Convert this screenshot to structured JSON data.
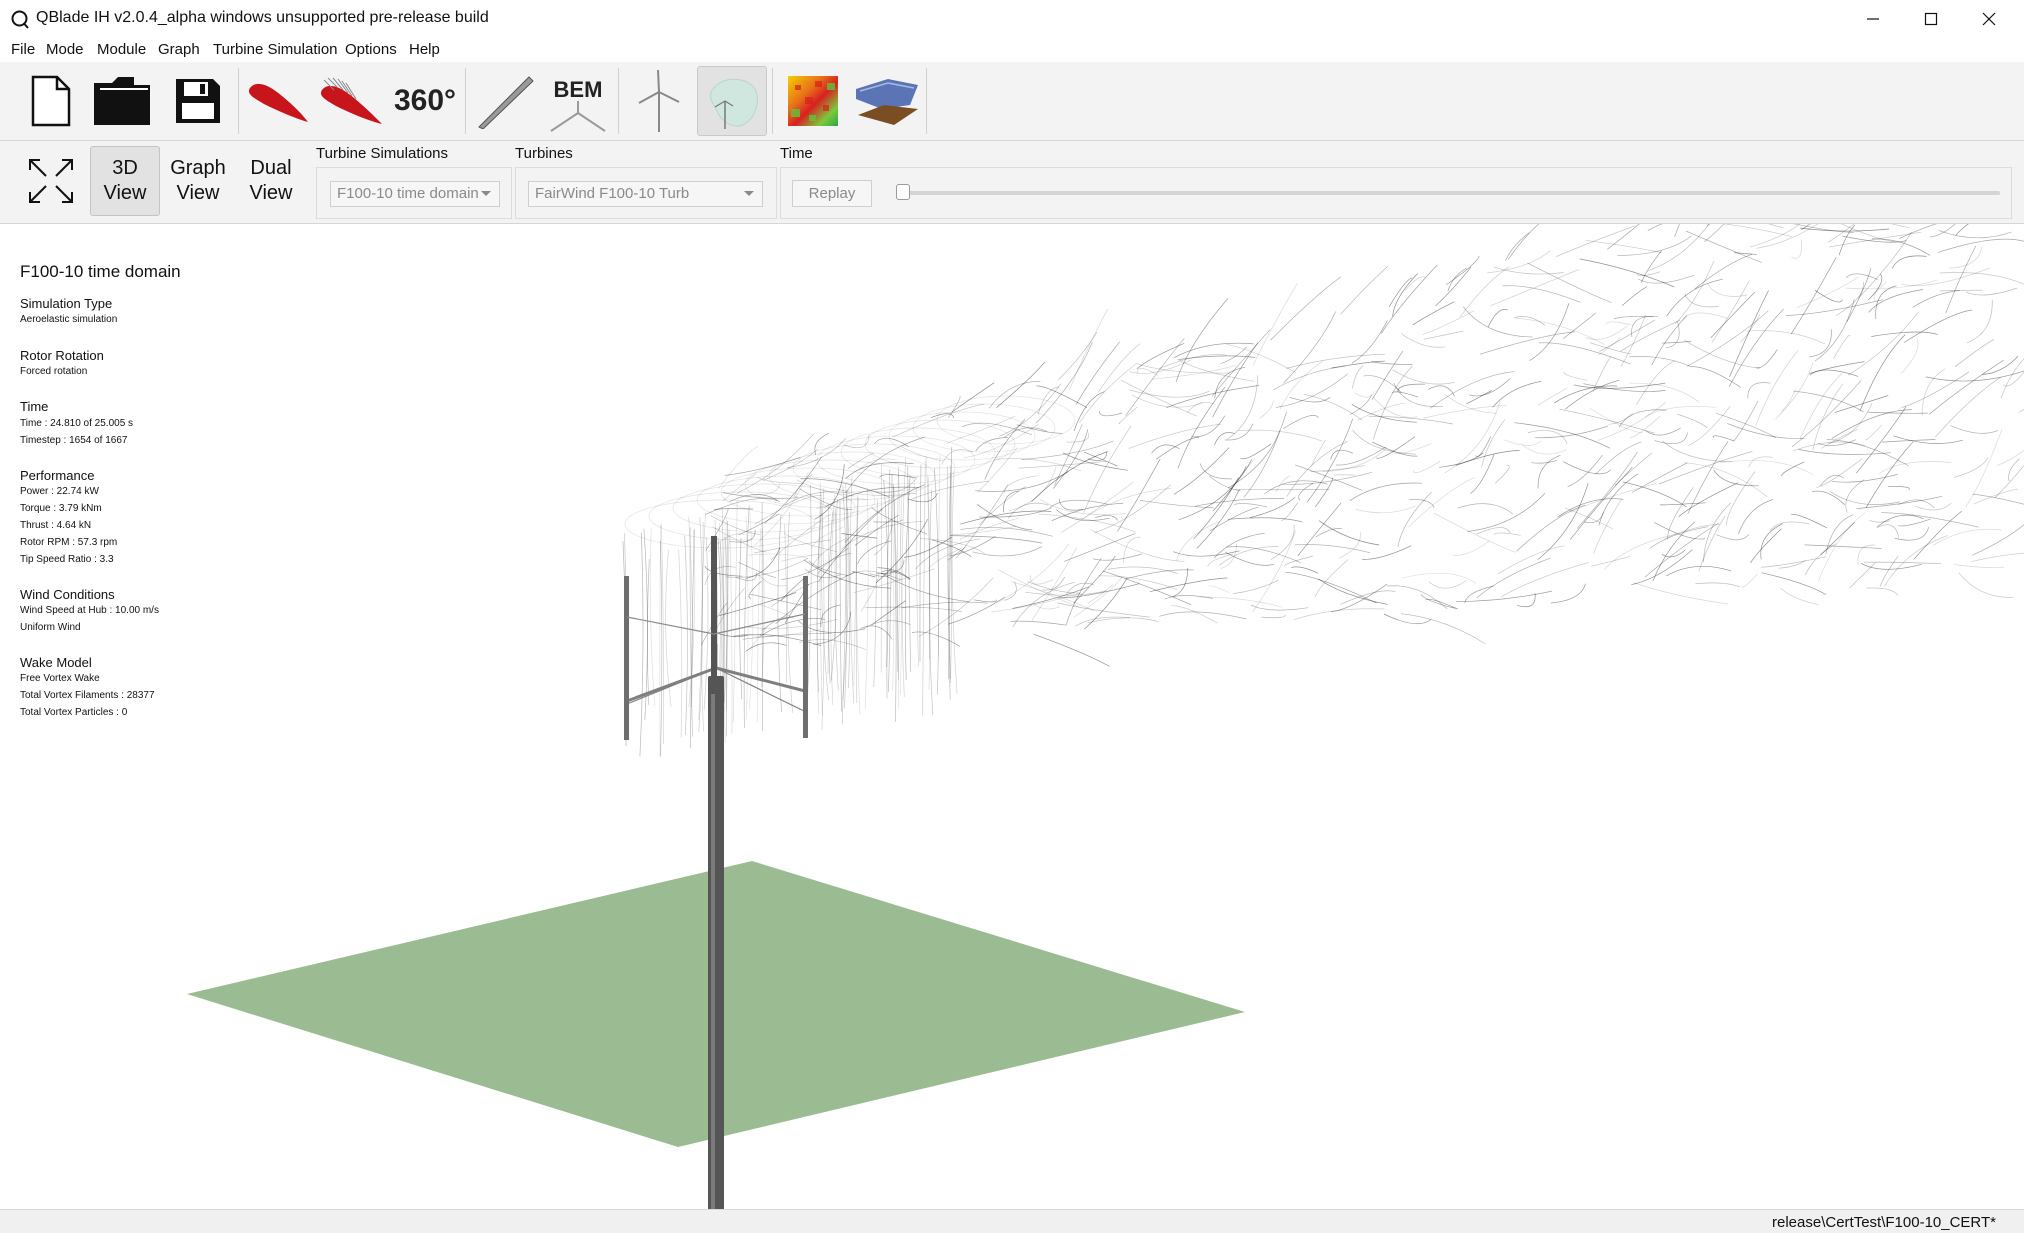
{
  "window": {
    "title": "QBlade IH v2.0.4_alpha windows unsupported pre-release build"
  },
  "menu": {
    "items": [
      "File",
      "Mode",
      "Module",
      "Graph",
      "Turbine Simulation",
      "Options",
      "Help"
    ]
  },
  "toolbar": {
    "polar_360_label": "360°",
    "bem_label": "BEM",
    "active_module": "turbine-simulation"
  },
  "view_toolbar": {
    "view_3d": [
      "3D",
      "View"
    ],
    "graph_view": [
      "Graph",
      "View"
    ],
    "dual_view": [
      "Dual",
      "View"
    ],
    "turbine_simulations_label": "Turbine Simulations",
    "turbine_simulation_selected": "F100-10 time domain",
    "turbines_label": "Turbines",
    "turbine_selected": "FairWind F100-10 Turb",
    "time_label": "Time",
    "replay_label": "Replay",
    "time_slider_fraction": 0.0
  },
  "info": {
    "title": "F100-10 time domain",
    "sections": [
      {
        "heading": "Simulation Type",
        "lines": [
          "Aeroelastic simulation"
        ]
      },
      {
        "heading": "Rotor Rotation",
        "lines": [
          "Forced rotation"
        ]
      },
      {
        "heading": "Time",
        "lines": [
          "Time : 24.810 of 25.005 s",
          "Timestep : 1654 of 1667"
        ]
      },
      {
        "heading": "Performance",
        "lines": [
          "Power : 22.74 kW",
          "Torque : 3.79 kNm",
          "Thrust : 4.64 kN",
          "Rotor RPM : 57.3 rpm",
          "Tip Speed Ratio : 3.3"
        ]
      },
      {
        "heading": "Wind Conditions",
        "lines": [
          "Wind Speed at Hub : 10.00 m/s",
          "Uniform Wind"
        ]
      },
      {
        "heading": "Wake Model",
        "lines": [
          "Free Vortex Wake",
          "Total Vortex Filaments : 28377",
          "Total Vortex Particles : 0"
        ]
      }
    ]
  },
  "status": {
    "path": "release\\CertTest\\F100-10_CERT*"
  },
  "colors": {
    "ground": "#9bbb92",
    "tower": "#555555",
    "wake": "#1a1a1a",
    "airfoil_red": "#c8151b"
  }
}
